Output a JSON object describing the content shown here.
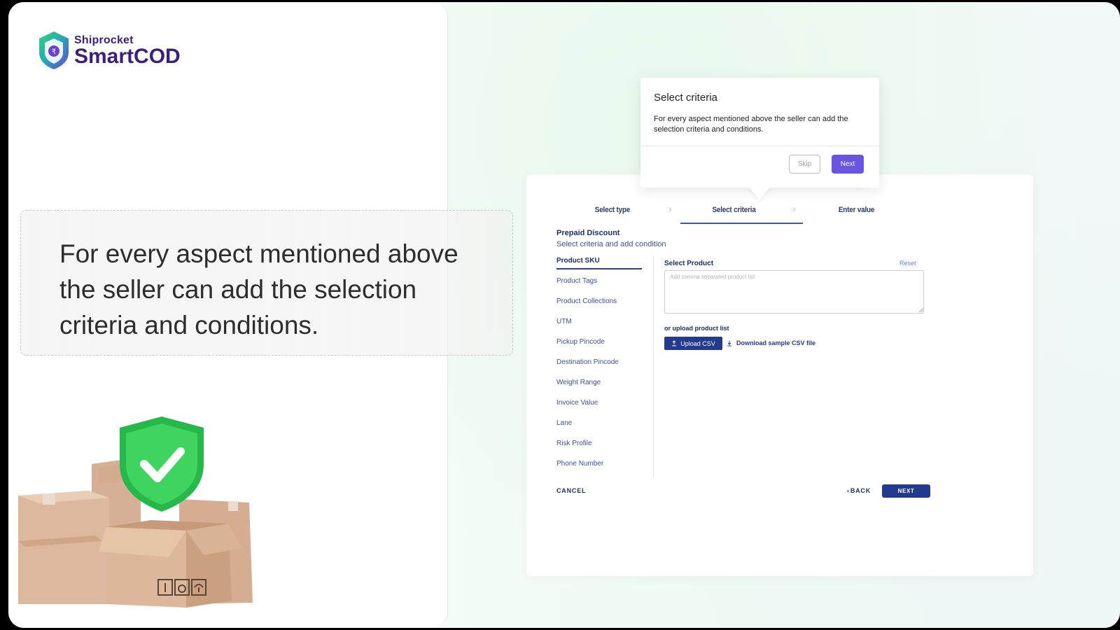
{
  "brand": {
    "small": "Shiprocket",
    "big": "SmartCOD"
  },
  "headline": "For every aspect mentioned above the seller can add the selection criteria and conditions.",
  "popover": {
    "title": "Select criteria",
    "body": "For every aspect mentioned above the seller can add the selection criteria and conditions.",
    "skip_label": "Skip",
    "next_label": "Next"
  },
  "steps": [
    {
      "label": "Select type"
    },
    {
      "label": "Select criteria"
    },
    {
      "label": "Enter value"
    }
  ],
  "form": {
    "title": "Prepaid Discount",
    "subtitle": "Select criteria and add condition",
    "criteria": [
      "Product SKU",
      "Product Tags",
      "Product Collections",
      "UTM",
      "Pickup Pincode",
      "Destination Pincode",
      "Weight Range",
      "Invoice Value",
      "Lane",
      "Risk Profile",
      "Phone Number"
    ],
    "select_product_label": "Select Product",
    "reset_label": "Reset",
    "product_placeholder": "Add comma separated product list",
    "upload_label": "or upload product list",
    "upload_button": "Upload CSV",
    "download_link": "Download sample CSV file",
    "cancel_label": "CANCEL",
    "back_label": "BACK",
    "next_label": "NEXT"
  },
  "colors": {
    "brand_purple": "#3b1f7a",
    "primary_navy": "#233a8f",
    "popover_accent": "#6a55e0",
    "shield_green": "#2fbf4a"
  }
}
